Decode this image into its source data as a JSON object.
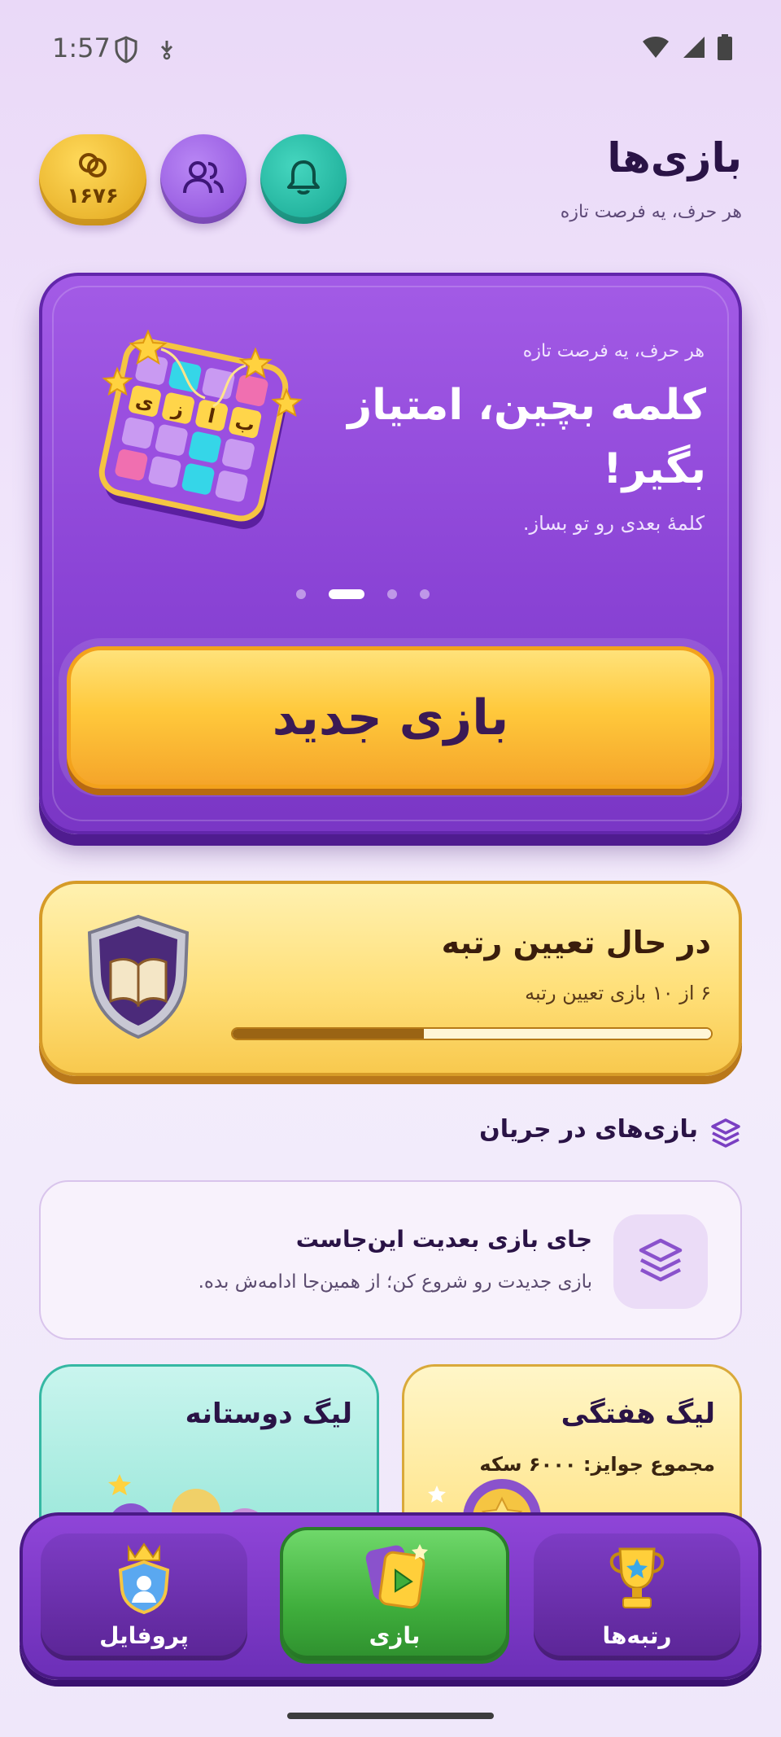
{
  "status_bar": {
    "time": "1:57"
  },
  "header": {
    "title": "بازی‌ها",
    "subtitle": "هر حرف، یه فرصت تازه",
    "coins": "۱۶۷۶"
  },
  "hero": {
    "tagline": "هر حرف، یه فرصت تازه",
    "heading": "کلمه بچین، امتیاز بگیر!",
    "description": "کلمهٔ بعدی رو تو بساز.",
    "carousel_active_index": 1,
    "carousel_count": 4,
    "badge_letters": [
      "ب",
      "ا",
      "ز",
      "ی"
    ],
    "new_game_label": "بازی جدید"
  },
  "ranking": {
    "title": "در حال تعیین رتبه",
    "subtitle": "۶ از ۱۰ بازی تعیین رتبه",
    "progress": 0.6
  },
  "ongoing": {
    "section_title": "بازی‌های در جریان",
    "empty_title": "جای بازی بعدیت این‌جاست",
    "empty_desc": "بازی جدیدت رو شروع کن؛ از همین‌جا ادامه‌ش بده."
  },
  "leagues": {
    "friends_title": "لیگ دوستانه",
    "weekly_title": "لیگ هفتگی",
    "weekly_prize": "مجموع جوایز: ۶۰۰۰ سکه"
  },
  "nav": {
    "profile": "پروفایل",
    "play": "بازی",
    "ranks": "رتبه‌ها"
  },
  "colors": {
    "accent_purple": "#8b44d6",
    "gold": "#ffc93c",
    "green_active": "#3fae3c",
    "teal": "#14a48f"
  }
}
